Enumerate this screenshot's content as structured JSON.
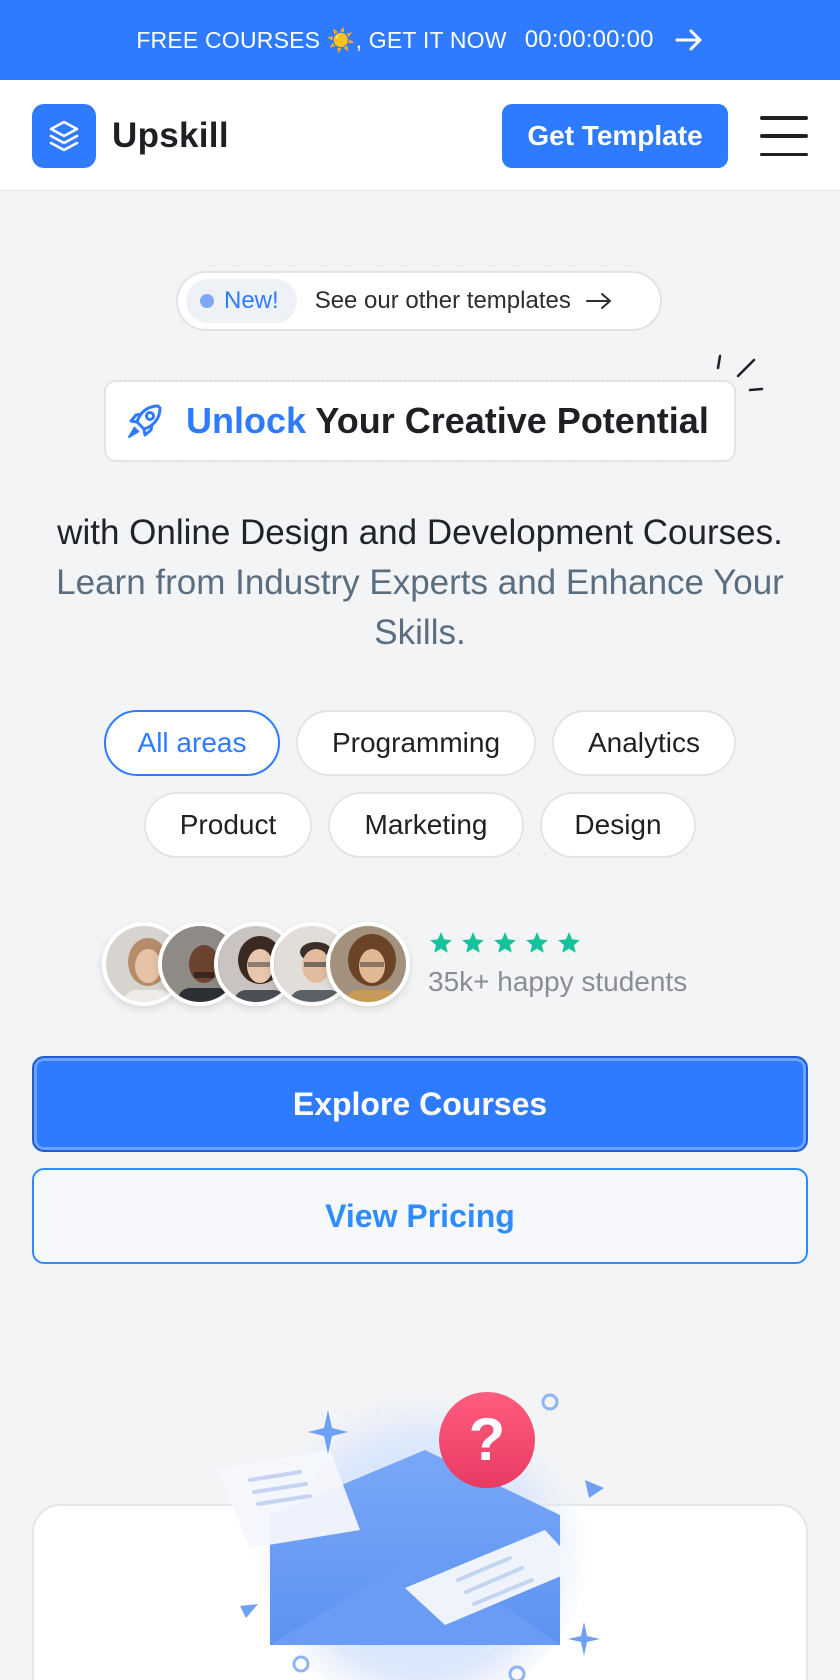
{
  "promo": {
    "text": "FREE COURSES",
    "emoji": "☀️",
    "text2": ", GET IT NOW",
    "countdown": "00:00:00:00"
  },
  "header": {
    "brand": "Upskill",
    "cta_label": "Get Template"
  },
  "announcement": {
    "badge": "New!",
    "text": "See our other templates"
  },
  "hero": {
    "title_accent": "Unlock",
    "title_rest": "Your Creative Potential",
    "subtitle_dark": "with Online Design and Development Courses.",
    "subtitle_muted": "Learn from Industry Experts and Enhance Your Skills."
  },
  "categories": [
    {
      "label": "All areas",
      "active": true
    },
    {
      "label": "Programming",
      "active": false
    },
    {
      "label": "Analytics",
      "active": false
    },
    {
      "label": "Product",
      "active": false
    },
    {
      "label": "Marketing",
      "active": false
    },
    {
      "label": "Design",
      "active": false
    }
  ],
  "social_proof": {
    "rating": 5,
    "students": "35k+ happy students"
  },
  "actions": {
    "primary": "Explore Courses",
    "secondary": "View Pricing"
  },
  "colors": {
    "brand": "#2f7bff",
    "stars": "#17c29a",
    "accent_pink": "#f0466e"
  }
}
